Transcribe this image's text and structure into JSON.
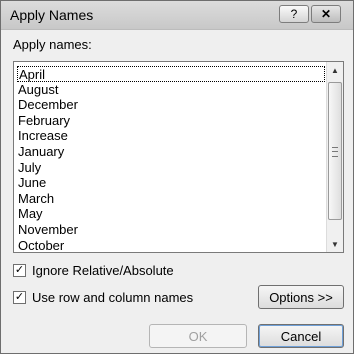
{
  "window": {
    "title": "Apply Names",
    "help_label": "?",
    "close_label": "✕"
  },
  "apply_names_label": "Apply names:",
  "names_list": [
    "April",
    "August",
    "December",
    "February",
    "Increase",
    "January",
    "July",
    "June",
    "March",
    "May",
    "November",
    "October"
  ],
  "selected_item": "April",
  "ignore_relative": {
    "label": "Ignore Relative/Absolute",
    "checked": true
  },
  "use_row_col": {
    "label": "Use row and column names",
    "checked": true
  },
  "buttons": {
    "options": "Options >>",
    "ok": "OK",
    "cancel": "Cancel"
  },
  "check_glyph": "✓",
  "scroll": {
    "up_glyph": "▲",
    "down_glyph": "▼"
  }
}
